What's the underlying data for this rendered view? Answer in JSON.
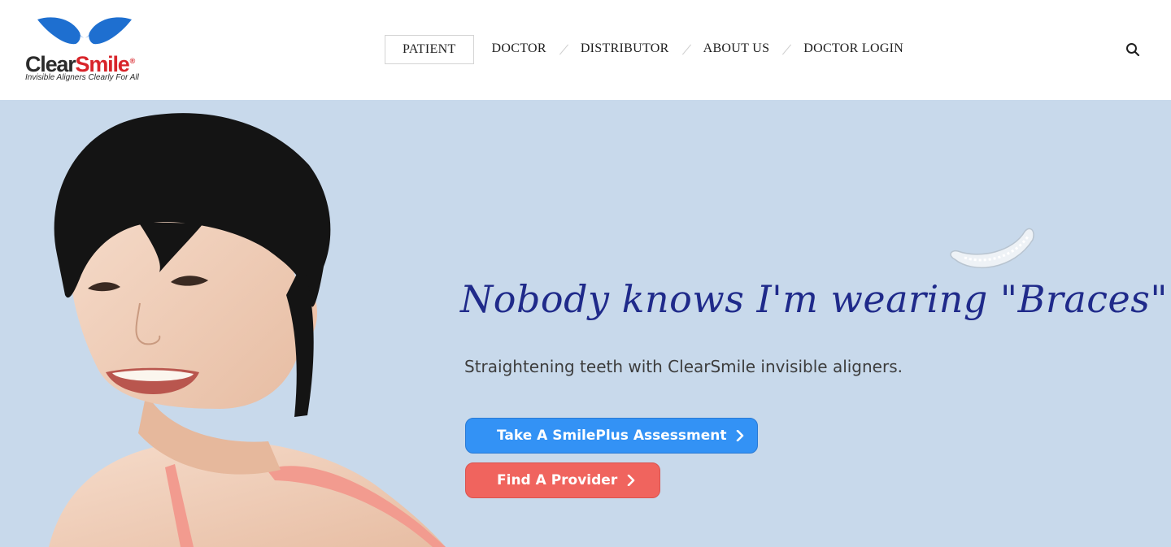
{
  "brand": {
    "name_part1": "Clear",
    "name_part2": "Smile",
    "registered": "®",
    "tagline": "Invisible Aligners Clearly For All",
    "colors": {
      "dark": "#2b2b2b",
      "red": "#d8242a",
      "blue": "#1e6fd0"
    }
  },
  "nav": {
    "items": [
      {
        "label": "PATIENT",
        "active": true
      },
      {
        "label": "DOCTOR",
        "active": false
      },
      {
        "label": "DISTRIBUTOR",
        "active": false
      },
      {
        "label": "ABOUT US",
        "active": false
      },
      {
        "label": "DOCTOR LOGIN",
        "active": false
      }
    ],
    "search_icon": "search-icon"
  },
  "hero": {
    "headline": "Nobody knows I'm wearing \"Braces\"",
    "subtitle": "Straightening teeth with ClearSmile invisible aligners.",
    "background_color": "#c8d9eb",
    "primary_button": {
      "label": "Take A SmilePlus Assessment",
      "icon": "chevron-right-icon",
      "color": "#3392f5"
    },
    "secondary_button": {
      "label": "Find A Provider",
      "icon": "chevron-right-icon",
      "color": "#f0645e"
    }
  }
}
